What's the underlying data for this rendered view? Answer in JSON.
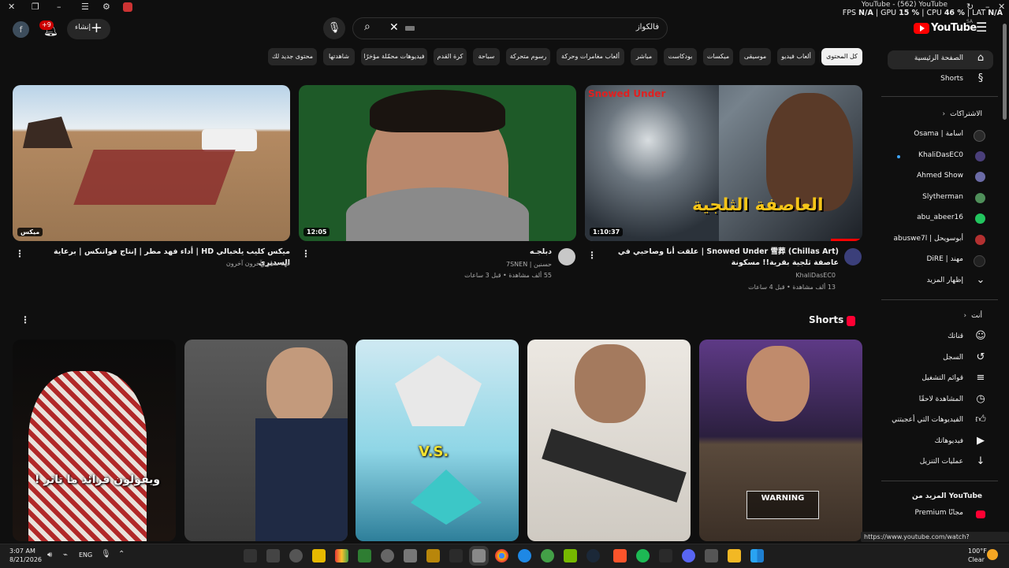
{
  "browser": {
    "tab_title": "YouTube - (562) YouTube",
    "perf": {
      "fps_label": "FPS",
      "fps": "N/A",
      "gpu_label": "GPU",
      "gpu": "15 %",
      "cpu_label": "CPU",
      "cpu": "46 %",
      "lat_label": "LAT",
      "lat": "N/A"
    }
  },
  "header": {
    "avatar_letter": "f",
    "notification_count": "+9",
    "create_label": "إنشاء",
    "search_value": "فالكواز",
    "logo_word": "YouTube",
    "logo_country": "SA"
  },
  "chips": [
    "كل المحتوى",
    "ألعاب فيديو",
    "موسيقى",
    "ميكسات",
    "بودكاست",
    "مباشر",
    "ألعاب مغامرات وحركة",
    "رسوم متحركة",
    "سباحة",
    "كرة القدم",
    "فيديوهات محمّلة مؤخرًا",
    "شاهدتها",
    "محتوى جديد لك"
  ],
  "sidebar": {
    "home": "الصفحة الرئيسية",
    "shorts": "Shorts",
    "subscriptions_header": "الاشتراكات",
    "subscriptions": [
      "Osama | اسامة",
      "KhaliDasEC0",
      "Ahmed Show",
      "Slytherman",
      "abu_abeer16",
      "abuswe7l | أبوسويحل",
      "DiRE | مهند"
    ],
    "show_more": "إظهار المزيد",
    "you_header": "أنت",
    "you_items": [
      "قناتك",
      "السجل",
      "قوائم التشغيل",
      "المشاهدة لاحقًا",
      "الفيديوهات التي أعجبتني",
      "فيديوهاتك",
      "عمليات التنزيل"
    ],
    "more_header": "المزيد من YouTube",
    "premium": "Premium مجانًا"
  },
  "videos": [
    {
      "title": "Snowed Under 雪葬 (Chillas Art) | علقت أنا وصاحبي في عاصفة ثلجية بقرية!! مسكونة",
      "channel": "KhaliDasEC0",
      "meta": "13 ألف مشاهدة • قبل 4 ساعات",
      "duration": "1:10:37",
      "overlay_text": "العاصفة الثلجية",
      "thumb_title": "Snowed Under"
    },
    {
      "title": "دبلجـه",
      "channel": "حسنين | 7SNEN",
      "meta": "55 ألف مشاهدة • قبل 3 ساعات",
      "duration": "12:05"
    },
    {
      "title": "ميكس كليب يلخبالي HD | أداء فهد مطر | إنتاج فواتنكس | برعاية السديري",
      "channel": "فهد مطر وآخرون آخرون",
      "meta": "",
      "duration": "ميكس"
    }
  ],
  "shorts": {
    "title": "Shorts",
    "items": [
      {
        "caption": "",
        "warning": "WARNING"
      },
      {
        "caption": ""
      },
      {
        "caption": "V.S."
      },
      {
        "caption": ""
      },
      {
        "caption": "ويقولون قرائد ما تاثر !"
      }
    ]
  },
  "taskbar": {
    "time": "3:07 AM",
    "date": "8/21/2026",
    "lang": "ENG",
    "temp": "100°F",
    "weather": "Clear"
  },
  "status_url": "https://www.youtube.com/watch?v=lUjKUWNuHgo",
  "colors": {
    "bg": "#0f0f0f",
    "brand": "#ff0000",
    "chip": "#272727"
  }
}
